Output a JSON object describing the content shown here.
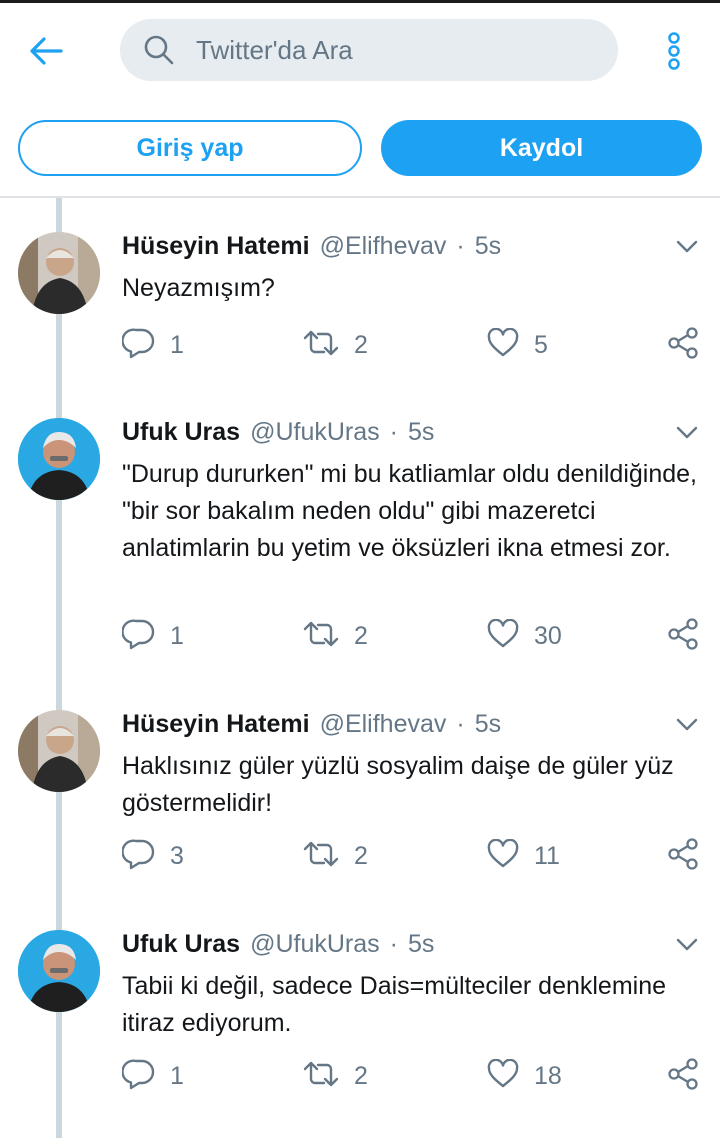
{
  "header": {
    "search_placeholder": "Twitter'da Ara",
    "login_label": "Giriş yap",
    "signup_label": "Kaydol"
  },
  "colors": {
    "accent": "#1da1f2",
    "muted": "#657786",
    "thread_line": "#ccd6dd"
  },
  "icons": [
    "back-arrow-icon",
    "search-icon",
    "more-vertical-icon",
    "chevron-down-icon",
    "reply-icon",
    "retweet-icon",
    "like-icon",
    "share-icon"
  ],
  "tweets": [
    {
      "name": "Hüseyin Hatemi",
      "handle": "@Elifhevav",
      "time": "5s",
      "text": "Neyazmışım?",
      "replies": "1",
      "retweets": "2",
      "likes": "5"
    },
    {
      "name": "Ufuk Uras",
      "handle": "@UfukUras",
      "time": "5s",
      "text": "\"Durup dururken\" mi bu katliamlar oldu denildiğinde, \"bir sor bakalım neden oldu\" gibi mazeretci anlatimlarin bu yetim ve öksüzleri ikna etmesi zor.",
      "replies": "1",
      "retweets": "2",
      "likes": "30"
    },
    {
      "name": "Hüseyin Hatemi",
      "handle": "@Elifhevav",
      "time": "5s",
      "text": "Haklısınız güler yüzlü sosyalim daişe de güler yüz göstermelidir!",
      "replies": "3",
      "retweets": "2",
      "likes": "11"
    },
    {
      "name": "Ufuk Uras",
      "handle": "@UfukUras",
      "time": "5s",
      "text": "Tabii ki değil, sadece Dais=mülteciler denklemine itiraz ediyorum.",
      "replies": "1",
      "retweets": "2",
      "likes": "18"
    }
  ]
}
